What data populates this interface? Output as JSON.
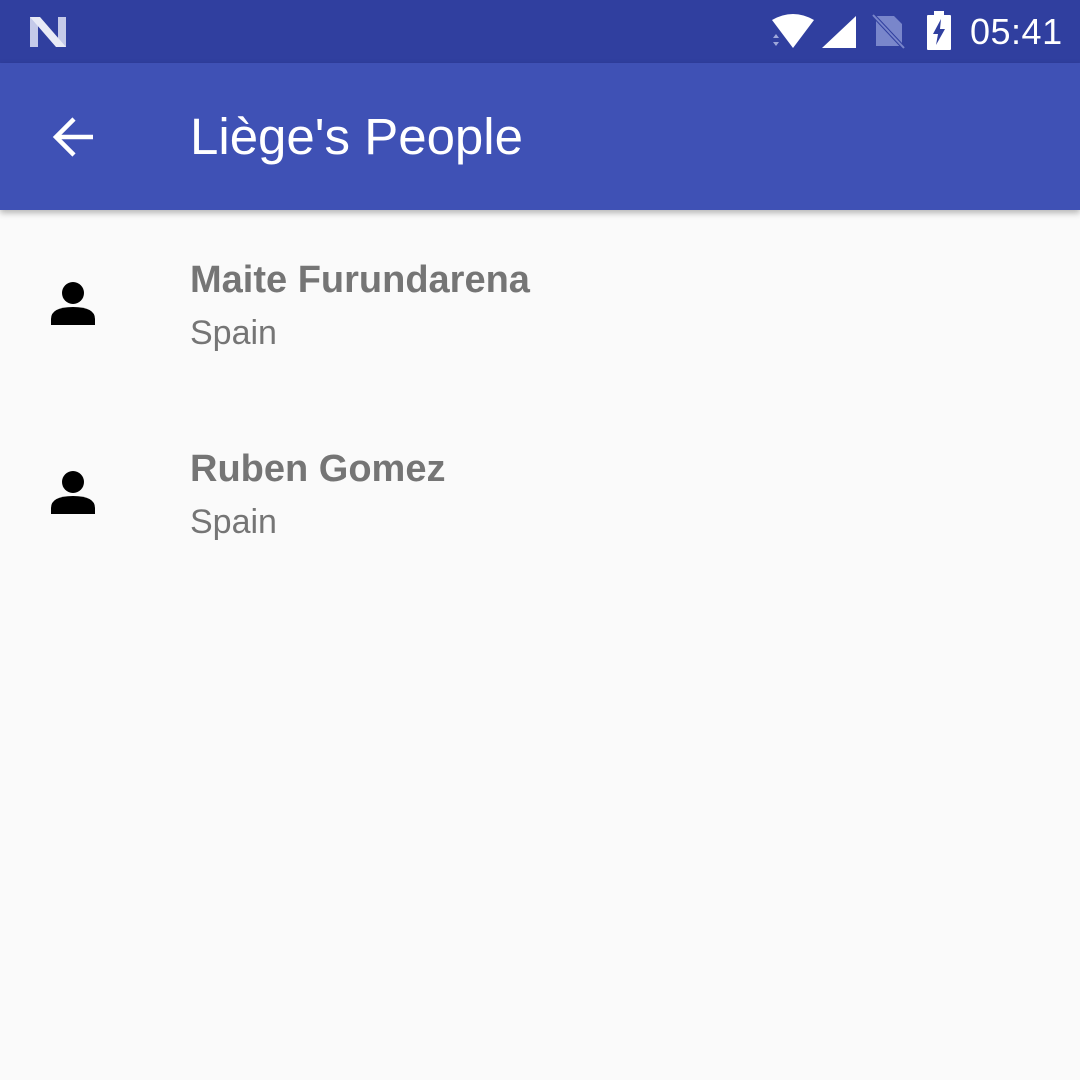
{
  "status_bar": {
    "time": "05:41",
    "icons": [
      "n-logo-icon",
      "wifi-icon",
      "cell-signal-icon",
      "no-sim-icon",
      "battery-charging-icon"
    ],
    "background_color": "#303f9f"
  },
  "app_bar": {
    "title": "Liège's People",
    "back_icon": "arrow-back-icon",
    "background_color": "#3f51b5"
  },
  "people": [
    {
      "name": "Maite Furundarena",
      "country": "Spain",
      "icon": "person-icon"
    },
    {
      "name": "Ruben Gomez",
      "country": "Spain",
      "icon": "person-icon"
    }
  ]
}
